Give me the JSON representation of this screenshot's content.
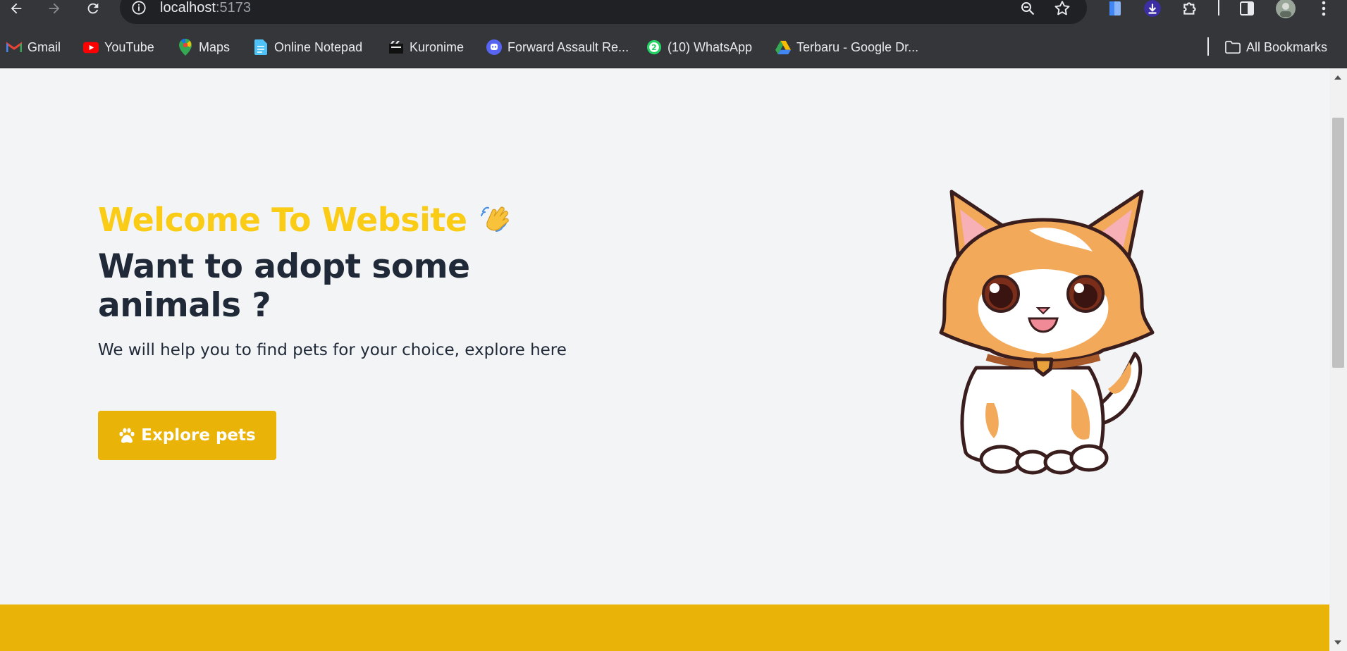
{
  "browser": {
    "url_host": "localhost",
    "url_port": ":5173",
    "bookmarks": [
      {
        "label": "Gmail",
        "icon": "gmail-icon"
      },
      {
        "label": "YouTube",
        "icon": "youtube-icon"
      },
      {
        "label": "Maps",
        "icon": "maps-icon"
      },
      {
        "label": "Online Notepad",
        "icon": "document-icon"
      },
      {
        "label": "Kuronime",
        "icon": "kuronime-icon"
      },
      {
        "label": "Forward Assault Re...",
        "icon": "discord-icon"
      },
      {
        "label": "(10) WhatsApp",
        "icon": "whatsapp-icon"
      },
      {
        "label": "Terbaru - Google Dr...",
        "icon": "google-drive-icon"
      }
    ],
    "all_bookmarks_label": "All Bookmarks",
    "whatsapp_badge": "2"
  },
  "hero": {
    "welcome": "Welcome To Website",
    "wave_emoji": "👋",
    "heading": "Want to adopt some animals ?",
    "subtitle": "We will help you to find pets for your choice, explore here",
    "button_label": "Explore pets",
    "button_icon": "paw-icon"
  },
  "colors": {
    "accent_yellow": "#facc15",
    "button_yellow": "#eab308",
    "text_dark": "#1f2937",
    "page_bg": "#f3f4f6"
  }
}
